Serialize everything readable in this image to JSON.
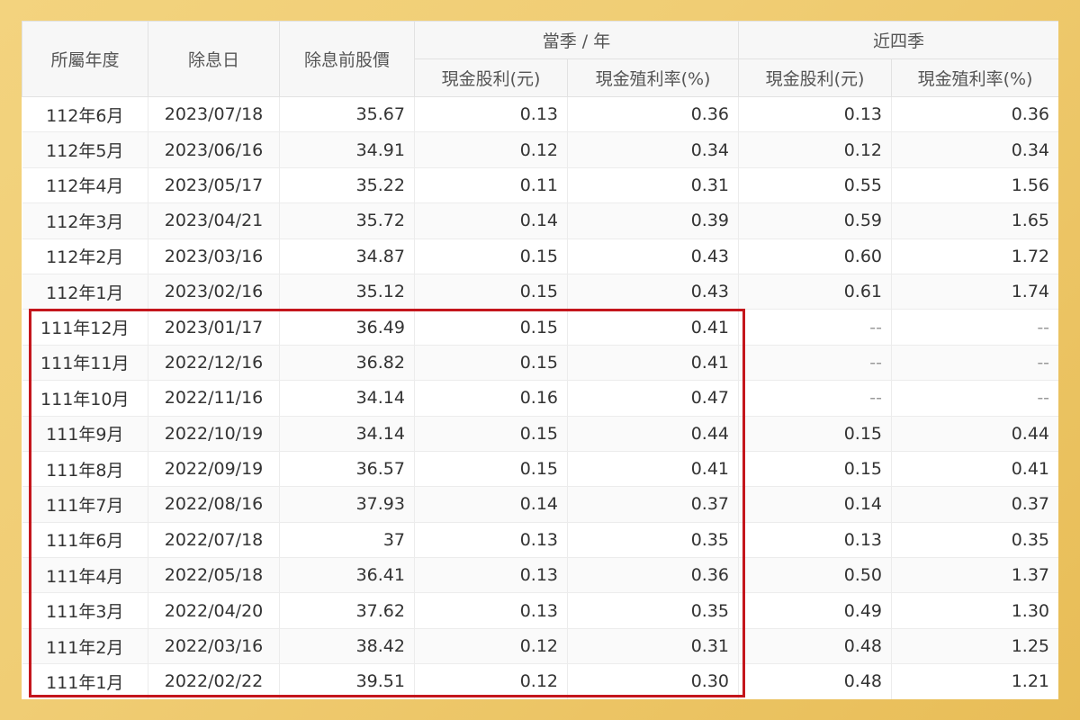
{
  "header": {
    "col_year": "所屬年度",
    "col_date": "除息日",
    "col_price": "除息前股價",
    "group_current": "當季 / 年",
    "group_recent": "近四季",
    "cash_dividend": "現金股利(元)",
    "cash_yield": "現金殖利率(%)"
  },
  "rows": [
    {
      "year": "112年6月",
      "date": "2023/07/18",
      "price": "35.67",
      "div": "0.13",
      "yield": "0.36",
      "div4": "0.13",
      "yield4": "0.36"
    },
    {
      "year": "112年5月",
      "date": "2023/06/16",
      "price": "34.91",
      "div": "0.12",
      "yield": "0.34",
      "div4": "0.12",
      "yield4": "0.34"
    },
    {
      "year": "112年4月",
      "date": "2023/05/17",
      "price": "35.22",
      "div": "0.11",
      "yield": "0.31",
      "div4": "0.55",
      "yield4": "1.56"
    },
    {
      "year": "112年3月",
      "date": "2023/04/21",
      "price": "35.72",
      "div": "0.14",
      "yield": "0.39",
      "div4": "0.59",
      "yield4": "1.65"
    },
    {
      "year": "112年2月",
      "date": "2023/03/16",
      "price": "34.87",
      "div": "0.15",
      "yield": "0.43",
      "div4": "0.60",
      "yield4": "1.72"
    },
    {
      "year": "112年1月",
      "date": "2023/02/16",
      "price": "35.12",
      "div": "0.15",
      "yield": "0.43",
      "div4": "0.61",
      "yield4": "1.74"
    },
    {
      "year": "111年12月",
      "date": "2023/01/17",
      "price": "36.49",
      "div": "0.15",
      "yield": "0.41",
      "div4": "--",
      "yield4": "--"
    },
    {
      "year": "111年11月",
      "date": "2022/12/16",
      "price": "36.82",
      "div": "0.15",
      "yield": "0.41",
      "div4": "--",
      "yield4": "--"
    },
    {
      "year": "111年10月",
      "date": "2022/11/16",
      "price": "34.14",
      "div": "0.16",
      "yield": "0.47",
      "div4": "--",
      "yield4": "--"
    },
    {
      "year": "111年9月",
      "date": "2022/10/19",
      "price": "34.14",
      "div": "0.15",
      "yield": "0.44",
      "div4": "0.15",
      "yield4": "0.44"
    },
    {
      "year": "111年8月",
      "date": "2022/09/19",
      "price": "36.57",
      "div": "0.15",
      "yield": "0.41",
      "div4": "0.15",
      "yield4": "0.41"
    },
    {
      "year": "111年7月",
      "date": "2022/08/16",
      "price": "37.93",
      "div": "0.14",
      "yield": "0.37",
      "div4": "0.14",
      "yield4": "0.37"
    },
    {
      "year": "111年6月",
      "date": "2022/07/18",
      "price": "37",
      "div": "0.13",
      "yield": "0.35",
      "div4": "0.13",
      "yield4": "0.35"
    },
    {
      "year": "111年4月",
      "date": "2022/05/18",
      "price": "36.41",
      "div": "0.13",
      "yield": "0.36",
      "div4": "0.50",
      "yield4": "1.37"
    },
    {
      "year": "111年3月",
      "date": "2022/04/20",
      "price": "37.62",
      "div": "0.13",
      "yield": "0.35",
      "div4": "0.49",
      "yield4": "1.30"
    },
    {
      "year": "111年2月",
      "date": "2022/03/16",
      "price": "38.42",
      "div": "0.12",
      "yield": "0.31",
      "div4": "0.48",
      "yield4": "1.25"
    },
    {
      "year": "111年1月",
      "date": "2022/02/22",
      "price": "39.51",
      "div": "0.12",
      "yield": "0.30",
      "div4": "0.48",
      "yield4": "1.21"
    }
  ],
  "highlight": {
    "from_year": "111年12月",
    "to_year": "111年1月",
    "color": "#c4161c"
  }
}
